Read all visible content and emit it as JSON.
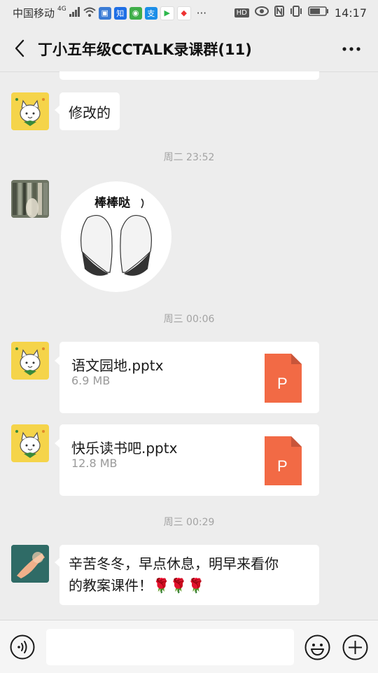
{
  "status_bar": {
    "carrier": "中国移动",
    "network": "4G",
    "app_icons": [
      "知",
      "支"
    ],
    "more": "···",
    "hd": "HD",
    "time": "14:17"
  },
  "header": {
    "title": "丁小五年级CCTALK录课群(11)"
  },
  "messages": {
    "msg1": {
      "text": "修改的"
    },
    "ts1": "周二 23:52",
    "sticker": {
      "text": "棒棒哒"
    },
    "ts2": "周三 00:06",
    "file1": {
      "name": "语文园地.pptx",
      "size": "6.9 MB",
      "icon_letter": "P"
    },
    "file2": {
      "name": "快乐读书吧.pptx",
      "size": "12.8 MB",
      "icon_letter": "P"
    },
    "ts3": "周三 00:29",
    "msg2": {
      "line1": "辛苦冬冬，早点休息，明早来看你",
      "line2": "的教案课件！🌹🌹🌹"
    }
  },
  "input": {
    "value": ""
  },
  "colors": {
    "bg": "#ededed",
    "file_orange": "#f26a45",
    "avatar_yellow": "#f5d44a"
  },
  "icons": {
    "back": "back-arrow-icon",
    "more": "more-dots-icon",
    "voice": "voice-icon",
    "emoji": "emoji-icon",
    "plus": "plus-icon",
    "file": "ppt-file-icon"
  }
}
